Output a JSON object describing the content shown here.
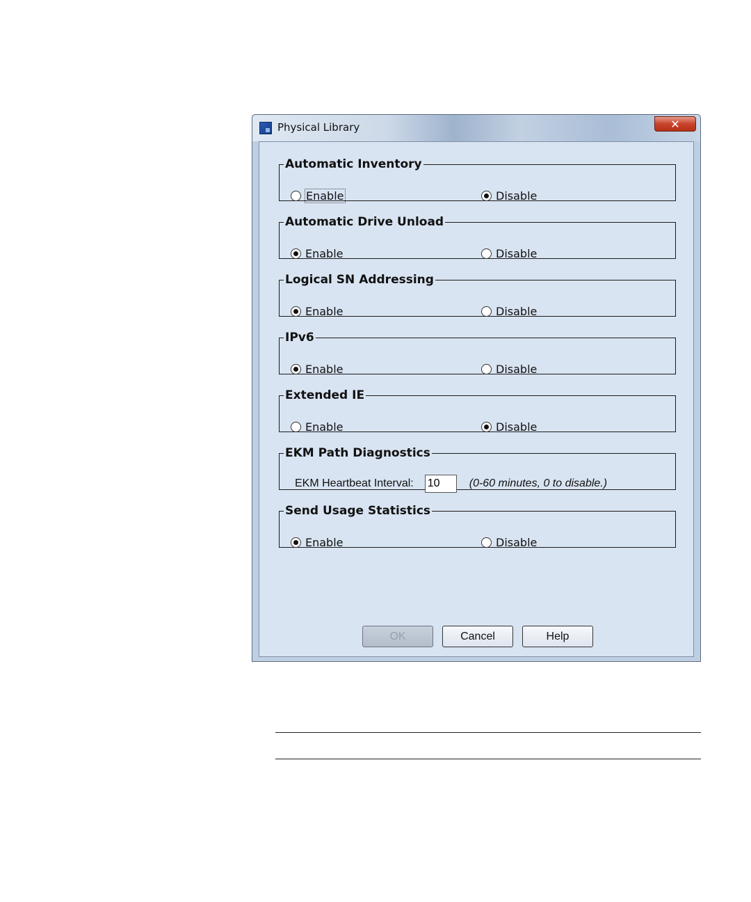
{
  "window": {
    "title": "Physical Library",
    "close_label": "✕"
  },
  "groups": [
    {
      "legend": "Automatic Inventory",
      "enable_label": "Enable",
      "disable_label": "Disable",
      "selected": "disable"
    },
    {
      "legend": "Automatic Drive Unload",
      "enable_label": "Enable",
      "disable_label": "Disable",
      "selected": "enable"
    },
    {
      "legend": "Logical SN Addressing",
      "enable_label": "Enable",
      "disable_label": "Disable",
      "selected": "enable"
    },
    {
      "legend": "IPv6",
      "enable_label": "Enable",
      "disable_label": "Disable",
      "selected": "enable"
    },
    {
      "legend": "Extended IE",
      "enable_label": "Enable",
      "disable_label": "Disable",
      "selected": "disable"
    }
  ],
  "ekm": {
    "legend": "EKM Path Diagnostics",
    "label": "EKM Heartbeat Interval:",
    "value": "10",
    "hint": "(0-60 minutes, 0 to disable.)"
  },
  "usage": {
    "legend": "Send Usage Statistics",
    "enable_label": "Enable",
    "disable_label": "Disable",
    "selected": "enable"
  },
  "buttons": {
    "ok": "OK",
    "cancel": "Cancel",
    "help": "Help"
  }
}
